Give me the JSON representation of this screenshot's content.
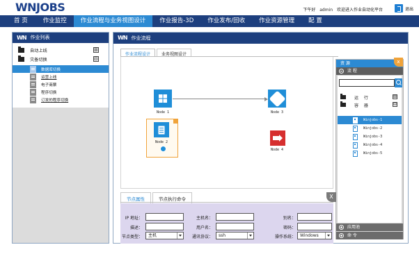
{
  "header": {
    "logo": "WNJOBS",
    "time_label": "下午好",
    "user": "admin",
    "welcome": "欢迎进入作业自动化平台",
    "exit_label": "退出"
  },
  "nav": {
    "items": [
      "首 页",
      "作业监控",
      "作业流程与业务视图设计",
      "作业报告-3D",
      "作业发布/回收",
      "作业资源管理",
      "配 置"
    ],
    "active_index": 2
  },
  "left": {
    "title": "作业列表",
    "groups": [
      {
        "label": "自动上线",
        "toggle": "⊞"
      },
      {
        "label": "灾备切换",
        "toggle": "⊟"
      }
    ],
    "items": [
      {
        "label": "数据库切换",
        "selected": true,
        "underline": false
      },
      {
        "label": "运营上线",
        "selected": false,
        "underline": true
      },
      {
        "label": "电子商票",
        "selected": false,
        "underline": false
      },
      {
        "label": "程序切换",
        "selected": false,
        "underline": false
      },
      {
        "label": "订发的程序切换",
        "selected": false,
        "underline": true
      }
    ]
  },
  "main": {
    "title": "作业流程",
    "tabs": [
      "作业流程设计",
      "业务视图设计"
    ],
    "nodes": [
      "Node 1",
      "Node 2",
      "Node 3",
      "Node 4"
    ]
  },
  "resources": {
    "title": "资 源",
    "flow_section": "流 程",
    "tree": [
      {
        "label": "运 行",
        "toggle": "⊞"
      },
      {
        "label": "容 器",
        "toggle": "⊟"
      }
    ],
    "jobs": [
      "Winjobs-1",
      "Winjobs-2",
      "Winjobs-3",
      "Winjobs-4",
      "Winjobs-5"
    ],
    "bottom_sections": [
      "应用池",
      "命 令"
    ],
    "search_placeholder": ""
  },
  "properties": {
    "tabs": [
      "节点属性",
      "节点执行命令"
    ],
    "fields": {
      "ip_label": "IP 地址：",
      "host_label": "主机名：",
      "alias_label": "别名：",
      "desc_label": "描述：",
      "user_label": "用户名：",
      "pwd_label": "密码：",
      "type_label": "节点类型：",
      "type_value": "主机",
      "proto_label": "通讯协议：",
      "proto_value": "ssh",
      "os_label": "操作系统：",
      "os_value": "Windows"
    }
  },
  "colors": {
    "nav_bg": "#1d3f7e",
    "accent": "#2c8ad3",
    "orange": "#f0a33a",
    "node_red": "#d62f2f"
  }
}
